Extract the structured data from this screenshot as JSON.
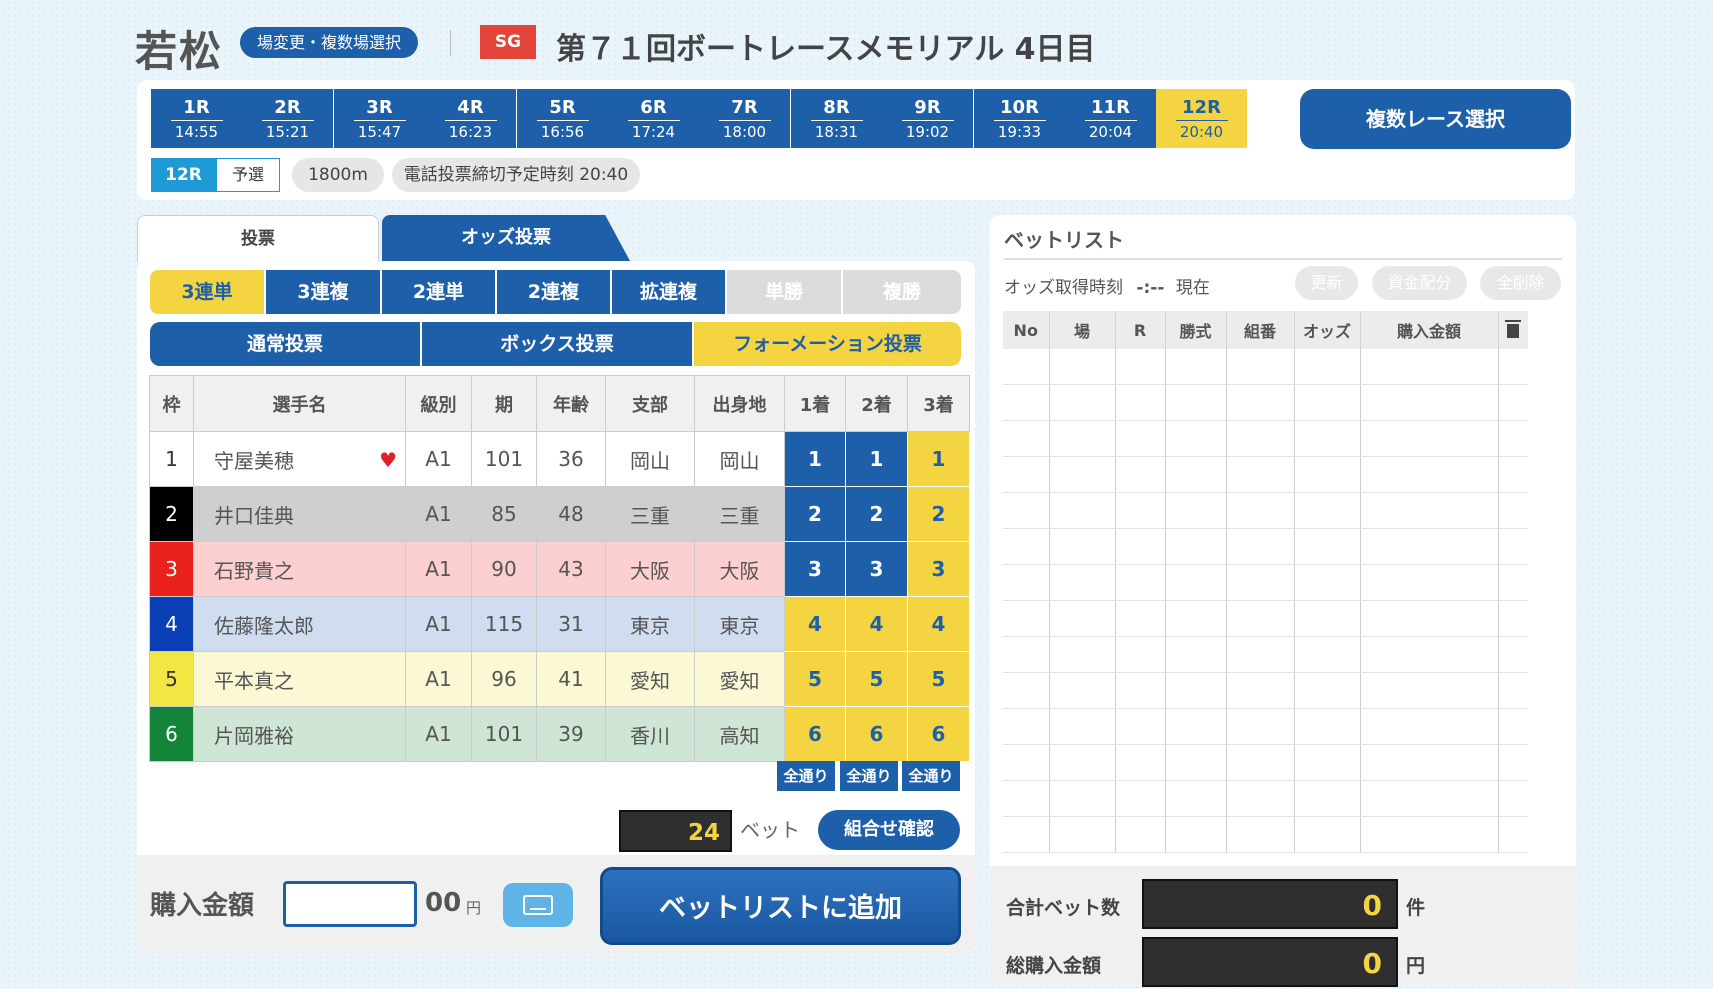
{
  "header": {
    "venue": "若松",
    "change_venue_label": "場変更・複数場選択",
    "grade": "SG",
    "race_title": "第７１回ボートレースメモリアル 4日目"
  },
  "races": [
    {
      "no": "1R",
      "time": "14:55"
    },
    {
      "no": "2R",
      "time": "15:21"
    },
    {
      "no": "3R",
      "time": "15:47"
    },
    {
      "no": "4R",
      "time": "16:23"
    },
    {
      "no": "5R",
      "time": "16:56"
    },
    {
      "no": "6R",
      "time": "17:24"
    },
    {
      "no": "7R",
      "time": "18:00"
    },
    {
      "no": "8R",
      "time": "18:31"
    },
    {
      "no": "9R",
      "time": "19:02"
    },
    {
      "no": "10R",
      "time": "19:33"
    },
    {
      "no": "11R",
      "time": "20:04"
    },
    {
      "no": "12R",
      "time": "20:40"
    }
  ],
  "multi_race_label": "複数レース選択",
  "race_info": {
    "race_no": "12R",
    "race_type": "予選",
    "distance": "1800m",
    "deadline": "電話投票締切予定時刻 20:40"
  },
  "tabs": {
    "vote": "投票",
    "odds_vote": "オッズ投票"
  },
  "bet_types": [
    "3連単",
    "3連複",
    "2連単",
    "2連複",
    "拡連複",
    "単勝",
    "複勝"
  ],
  "vote_modes": [
    "通常投票",
    "ボックス投票",
    "フォーメーション投票"
  ],
  "table": {
    "headers": [
      "枠",
      "選手名",
      "級別",
      "期",
      "年齢",
      "支部",
      "出身地",
      "1着",
      "2着",
      "3着"
    ],
    "rows": [
      {
        "frame": "1",
        "name": "守屋美穂",
        "class": "A1",
        "term": "101",
        "age": "36",
        "branch": "岡山",
        "birthplace": "岡山",
        "p1": "1",
        "p2": "1",
        "p3": "1"
      },
      {
        "frame": "2",
        "name": "井口佳典",
        "class": "A1",
        "term": "85",
        "age": "48",
        "branch": "三重",
        "birthplace": "三重",
        "p1": "2",
        "p2": "2",
        "p3": "2"
      },
      {
        "frame": "3",
        "name": "石野貴之",
        "class": "A1",
        "term": "90",
        "age": "43",
        "branch": "大阪",
        "birthplace": "大阪",
        "p1": "3",
        "p2": "3",
        "p3": "3"
      },
      {
        "frame": "4",
        "name": "佐藤隆太郎",
        "class": "A1",
        "term": "115",
        "age": "31",
        "branch": "東京",
        "birthplace": "東京",
        "p1": "4",
        "p2": "4",
        "p3": "4"
      },
      {
        "frame": "5",
        "name": "平本真之",
        "class": "A1",
        "term": "96",
        "age": "41",
        "branch": "愛知",
        "birthplace": "愛知",
        "p1": "5",
        "p2": "5",
        "p3": "5"
      },
      {
        "frame": "6",
        "name": "片岡雅裕",
        "class": "A1",
        "term": "101",
        "age": "39",
        "branch": "香川",
        "birthplace": "高知",
        "p1": "6",
        "p2": "6",
        "p3": "6"
      }
    ],
    "all_label": "全通り"
  },
  "bet_count": {
    "value": "24",
    "unit": "ベット",
    "confirm_label": "組合せ確認"
  },
  "purchase": {
    "label": "購入金額",
    "value": "",
    "suffix": "00",
    "yen": "円",
    "add_label": "ベットリストに追加"
  },
  "betlist": {
    "title": "ベットリスト",
    "odds_time_label": "オッズ取得時刻",
    "odds_time_value": "-:--",
    "odds_time_now": "現在",
    "buttons": [
      "更新",
      "資金配分",
      "全削除"
    ],
    "headers": [
      "No",
      "場",
      "R",
      "勝式",
      "組番",
      "オッズ",
      "購入金額"
    ],
    "empty_rows": 14,
    "total_bets_label": "合計ベット数",
    "total_bets_value": "0",
    "total_bets_unit": "件",
    "total_amount_label": "総購入金額",
    "total_amount_value": "0",
    "total_amount_unit": "円"
  },
  "colors": {
    "primary": "#1d5fa8",
    "accent": "#f5d442",
    "grade": "#e3453b",
    "frames": [
      "#ffffff",
      "#000000",
      "#e8211c",
      "#0b3fb6",
      "#f2e642",
      "#13843a"
    ],
    "row_bg": [
      "#ffffff",
      "#cfcfcf",
      "#fcd0d0",
      "#d0dcf0",
      "#fbf8d6",
      "#cfe6d6"
    ]
  }
}
